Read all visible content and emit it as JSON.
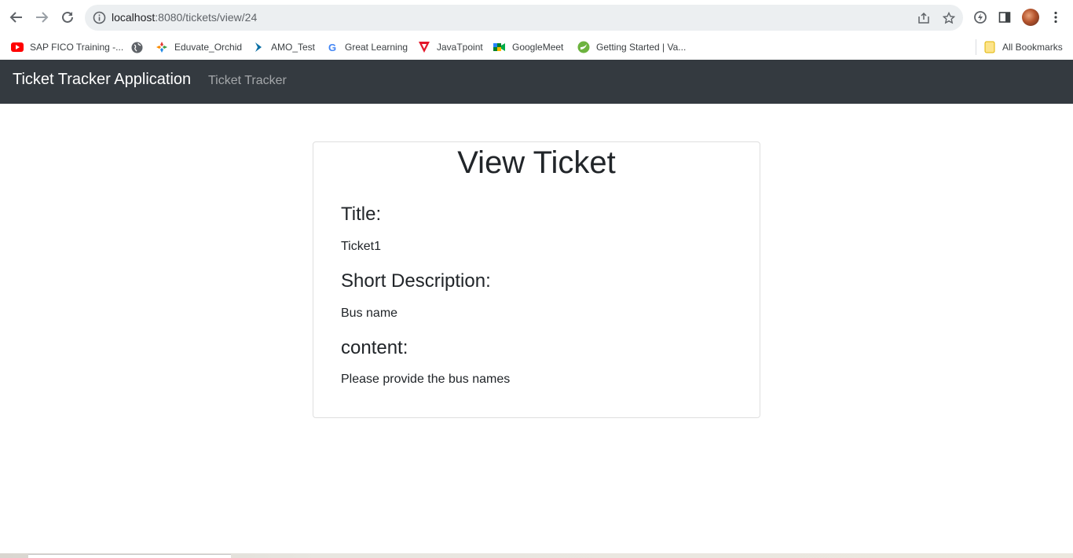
{
  "browser": {
    "url_host": "localhost",
    "url_rest": ":8080/tickets/view/24",
    "icons": {
      "back": "arrow-left-icon",
      "forward": "arrow-right-icon",
      "reload": "reload-icon",
      "info": "info-icon",
      "share": "share-icon",
      "bookmark": "star-icon",
      "extensions": "extension-icon",
      "sidepanel": "sidepanel-icon",
      "menu": "kebab-menu-icon"
    }
  },
  "bookmarks": [
    {
      "label": "SAP FICO Training -...",
      "icon": "youtube-icon"
    },
    {
      "label": "",
      "icon": "globe-icon"
    },
    {
      "label": "Eduvate_Orchid",
      "icon": "orchid-icon"
    },
    {
      "label": "AMO_Test",
      "icon": "arrow-icon"
    },
    {
      "label": "Great Learning",
      "icon": "google-icon"
    },
    {
      "label": "JavaTpoint",
      "icon": "javatpoint-icon"
    },
    {
      "label": "GoogleMeet",
      "icon": "meet-icon"
    },
    {
      "label": "Getting Started | Va...",
      "icon": "spring-icon"
    }
  ],
  "all_bookmarks": "All Bookmarks",
  "navbar": {
    "brand": "Ticket Tracker Application",
    "link": "Ticket Tracker"
  },
  "ticket": {
    "heading": "View Ticket",
    "title_label": "Title:",
    "title_value": "Ticket1",
    "desc_label": "Short Description:",
    "desc_value": "Bus name",
    "content_label": "content:",
    "content_value": "Please provide the bus names"
  },
  "colors": {
    "navbar_bg": "#343a40",
    "text": "#212529"
  }
}
